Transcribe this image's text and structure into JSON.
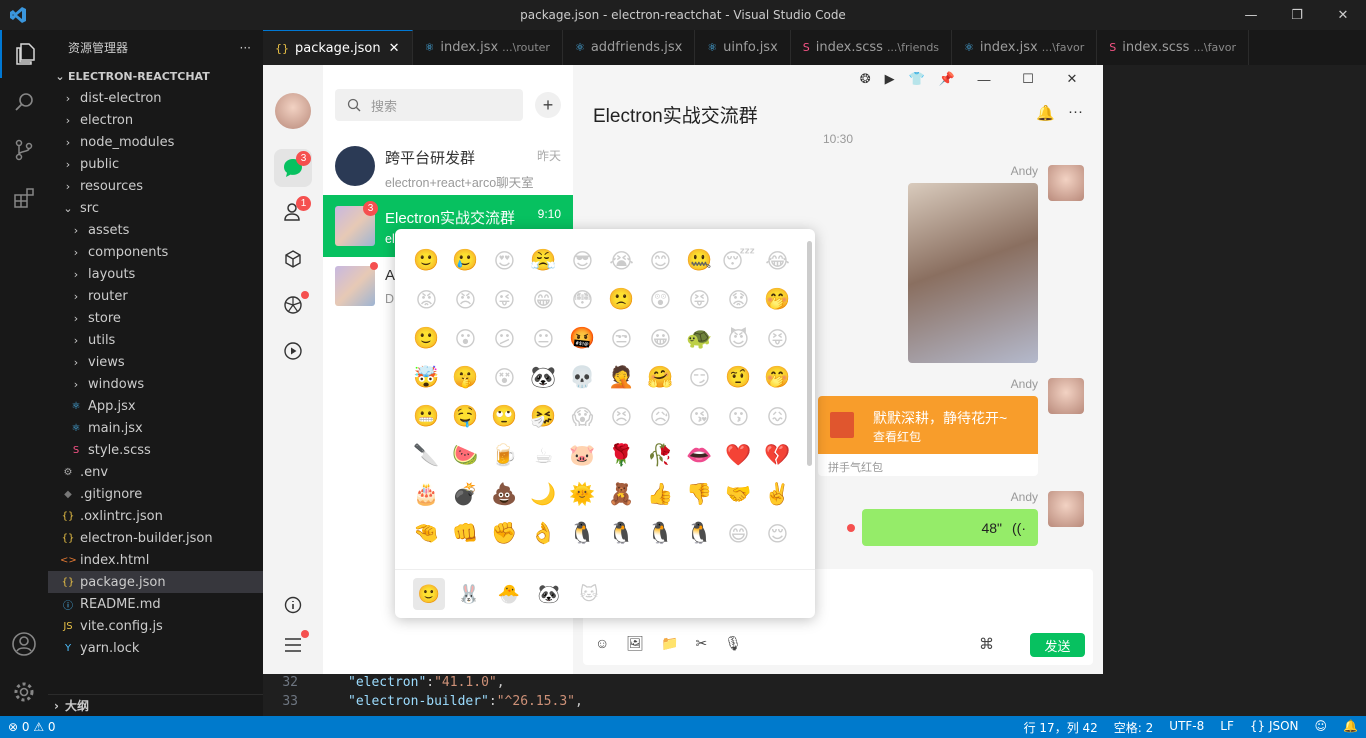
{
  "window": {
    "title": "package.json - electron-reactchat - Visual Studio Code",
    "min": "—",
    "max": "❐",
    "close": "✕"
  },
  "explorer": {
    "title": "资源管理器",
    "more": "···",
    "root": "ELECTRON-REACTCHAT",
    "items": [
      {
        "label": "dist-electron",
        "kind": "folder",
        "depth": 1
      },
      {
        "label": "electron",
        "kind": "folder",
        "depth": 1
      },
      {
        "label": "node_modules",
        "kind": "folder",
        "depth": 1
      },
      {
        "label": "public",
        "kind": "folder",
        "depth": 1
      },
      {
        "label": "resources",
        "kind": "folder",
        "depth": 1
      },
      {
        "label": "src",
        "kind": "folder-open",
        "depth": 1
      },
      {
        "label": "assets",
        "kind": "folder",
        "depth": 2
      },
      {
        "label": "components",
        "kind": "folder",
        "depth": 2
      },
      {
        "label": "layouts",
        "kind": "folder",
        "depth": 2
      },
      {
        "label": "router",
        "kind": "folder",
        "depth": 2
      },
      {
        "label": "store",
        "kind": "folder",
        "depth": 2
      },
      {
        "label": "utils",
        "kind": "folder",
        "depth": 2
      },
      {
        "label": "views",
        "kind": "folder",
        "depth": 2
      },
      {
        "label": "windows",
        "kind": "folder",
        "depth": 2
      },
      {
        "label": "App.jsx",
        "kind": "jsx",
        "depth": 2
      },
      {
        "label": "main.jsx",
        "kind": "jsx",
        "depth": 2
      },
      {
        "label": "style.scss",
        "kind": "scss",
        "depth": 2
      },
      {
        "label": ".env",
        "kind": "env",
        "depth": 1
      },
      {
        "label": ".gitignore",
        "kind": "git",
        "depth": 1
      },
      {
        "label": ".oxlintrc.json",
        "kind": "json",
        "depth": 1
      },
      {
        "label": "electron-builder.json",
        "kind": "json",
        "depth": 1
      },
      {
        "label": "index.html",
        "kind": "html",
        "depth": 1
      },
      {
        "label": "package.json",
        "kind": "json",
        "depth": 1,
        "selected": true
      },
      {
        "label": "README.md",
        "kind": "md",
        "depth": 1
      },
      {
        "label": "vite.config.js",
        "kind": "js",
        "depth": 1
      },
      {
        "label": "yarn.lock",
        "kind": "yarn",
        "depth": 1
      }
    ],
    "outline": "大纲"
  },
  "tabs": [
    {
      "label": "package.json",
      "hint": "",
      "kind": "json",
      "active": true
    },
    {
      "label": "index.jsx",
      "hint": "...\\router",
      "kind": "jsx"
    },
    {
      "label": "addfriends.jsx",
      "hint": "",
      "kind": "jsx"
    },
    {
      "label": "uinfo.jsx",
      "hint": "",
      "kind": "jsx"
    },
    {
      "label": "index.scss",
      "hint": "...\\friends",
      "kind": "scss"
    },
    {
      "label": "index.jsx",
      "hint": "...\\favor",
      "kind": "jsx"
    },
    {
      "label": "index.scss",
      "hint": "...\\favor",
      "kind": "scss"
    }
  ],
  "code": [
    {
      "ln": "32",
      "key": "\"electron\"",
      "val": "\"41.1.0\""
    },
    {
      "ln": "33",
      "key": "\"electron-builder\"",
      "val": "\"^26.15.3\""
    }
  ],
  "status": {
    "errors": "0",
    "warnings": "0",
    "position": "行 17，列 42",
    "spaces": "空格: 2",
    "encoding": "UTF-8",
    "eol": "LF",
    "lang": "{} JSON"
  },
  "app": {
    "search_placeholder": "搜索",
    "add": "+",
    "nav_badges": {
      "chat": "3",
      "contacts": "1"
    },
    "conversations": [
      {
        "name": "跨平台研发群",
        "sub": "electron+react+arco聊天室",
        "time": "昨天"
      },
      {
        "name": "Electron实战交流群",
        "sub": "el",
        "time": "9:10",
        "badge": "3",
        "active": true
      },
      {
        "name": "A",
        "sub": "D",
        "time": ""
      }
    ],
    "chat_title": "Electron实战交流群",
    "time_divider": "10:30",
    "sender": "Andy",
    "redpacket": {
      "title": "默默深耕，静待花开~",
      "sub": "查看红包",
      "footer": "拼手气红包"
    },
    "voice": {
      "duration": "48\""
    },
    "send": "发送",
    "emojis": [
      "🙂",
      "🥲",
      "😍",
      "😤",
      "😎",
      "😭",
      "😊",
      "🤐",
      "😴",
      "😂",
      "😡",
      "😠",
      "😜",
      "😁",
      "😳",
      "🙁",
      "😲",
      "😝",
      "😟",
      "🤭",
      "🙂",
      "😮",
      "😕",
      "😐",
      "🤬",
      "😒",
      "😀",
      "🐢",
      "😈",
      "😝",
      "🤯",
      "🤫",
      "😵",
      "🐼",
      "💀",
      "🤦",
      "🤗",
      "😏",
      "🤨",
      "🤭",
      "😬",
      "🤤",
      "🙄",
      "🤧",
      "😱",
      "😣",
      "😥",
      "😘",
      "😗",
      "😖",
      "🔪",
      "🍉",
      "🍺",
      "☕",
      "🐷",
      "🌹",
      "🥀",
      "👄",
      "❤️",
      "💔",
      "🎂",
      "💣",
      "💩",
      "🌙",
      "🌞",
      "🧸",
      "👍",
      "👎",
      "🤝",
      "✌️",
      "🤏",
      "👊",
      "✊",
      "👌",
      "🐧",
      "🐧",
      "🐧",
      "🐧",
      "😄",
      "😌"
    ],
    "emoji_tabs": [
      "🙂",
      "🐰",
      "🐣",
      "🐼",
      "🐱"
    ],
    "colors": {
      "accent": "#07c160",
      "red": "#f5504f",
      "orange": "#f89d2b",
      "voice": "#95ec69"
    }
  }
}
